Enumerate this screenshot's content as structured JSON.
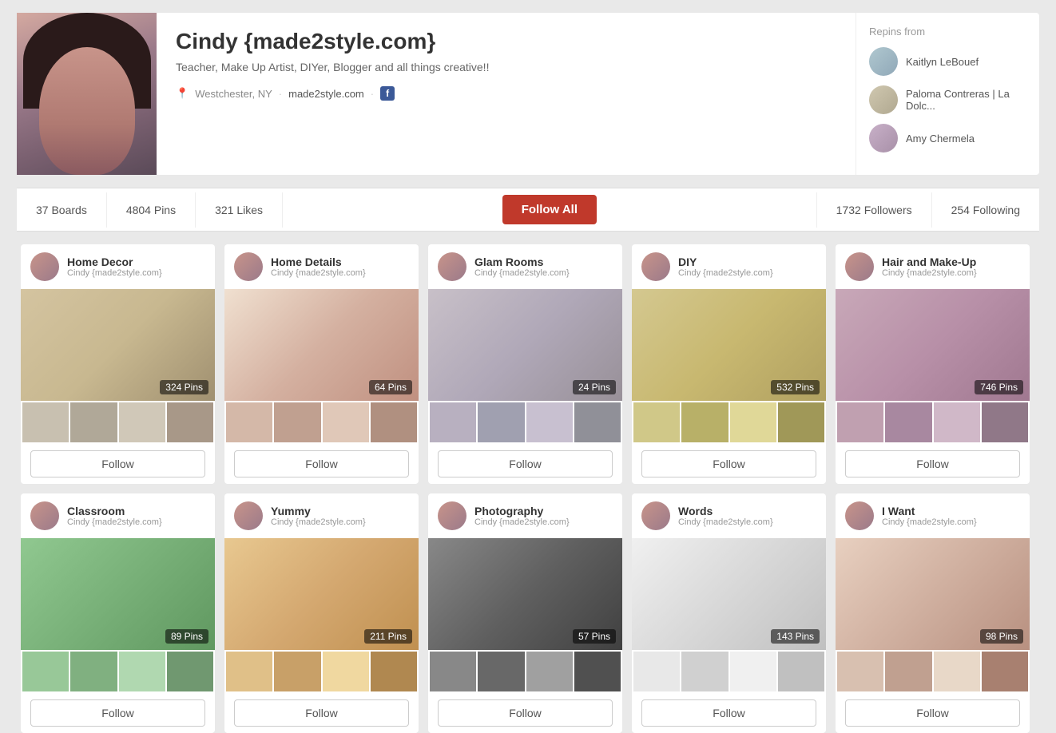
{
  "profile": {
    "name": "Cindy {made2style.com}",
    "bio": "Teacher, Make Up Artist, DIYer, Blogger and all things creative!!",
    "location": "Westchester, NY",
    "website": "made2style.com",
    "has_facebook": true
  },
  "repins": {
    "title": "Repins from",
    "people": [
      {
        "name": "Kaitlyn LeBouef",
        "avatar_class": "avatar-kaitlyn"
      },
      {
        "name": "Paloma Contreras | La Dolc...",
        "avatar_class": "avatar-paloma"
      },
      {
        "name": "Amy Chermela",
        "avatar_class": "avatar-amy"
      }
    ]
  },
  "stats": {
    "boards_label": "37 Boards",
    "pins_label": "4804 Pins",
    "likes_label": "321 Likes",
    "follow_all_label": "Follow All",
    "followers_label": "1732 Followers",
    "following_label": "254 Following"
  },
  "boards": [
    {
      "title": "Home Decor",
      "owner": "Cindy {made2style.com}",
      "pin_count": "324 Pins",
      "img_class": "img-home-decor",
      "follow_label": "Follow"
    },
    {
      "title": "Home Details",
      "owner": "Cindy {made2style.com}",
      "pin_count": "64 Pins",
      "img_class": "img-home-details",
      "follow_label": "Follow"
    },
    {
      "title": "Glam Rooms",
      "owner": "Cindy {made2style.com}",
      "pin_count": "24 Pins",
      "img_class": "img-glam-rooms",
      "follow_label": "Follow"
    },
    {
      "title": "DIY",
      "owner": "Cindy {made2style.com}",
      "pin_count": "532 Pins",
      "img_class": "img-diy",
      "follow_label": "Follow"
    },
    {
      "title": "Hair and Make-Up",
      "owner": "Cindy {made2style.com}",
      "pin_count": "746 Pins",
      "img_class": "img-hair-makeup",
      "follow_label": "Follow"
    },
    {
      "title": "Classroom",
      "owner": "Cindy {made2style.com}",
      "pin_count": "89 Pins",
      "img_class": "img-classroom",
      "follow_label": "Follow"
    },
    {
      "title": "Yummy",
      "owner": "Cindy {made2style.com}",
      "pin_count": "211 Pins",
      "img_class": "img-yummy",
      "follow_label": "Follow"
    },
    {
      "title": "Photography",
      "owner": "Cindy {made2style.com}",
      "pin_count": "57 Pins",
      "img_class": "img-photography",
      "follow_label": "Follow"
    },
    {
      "title": "Words",
      "owner": "Cindy {made2style.com}",
      "pin_count": "143 Pins",
      "img_class": "img-words",
      "follow_label": "Follow"
    },
    {
      "title": "I Want",
      "owner": "Cindy {made2style.com}",
      "pin_count": "98 Pins",
      "img_class": "img-i-want",
      "follow_label": "Follow"
    }
  ]
}
